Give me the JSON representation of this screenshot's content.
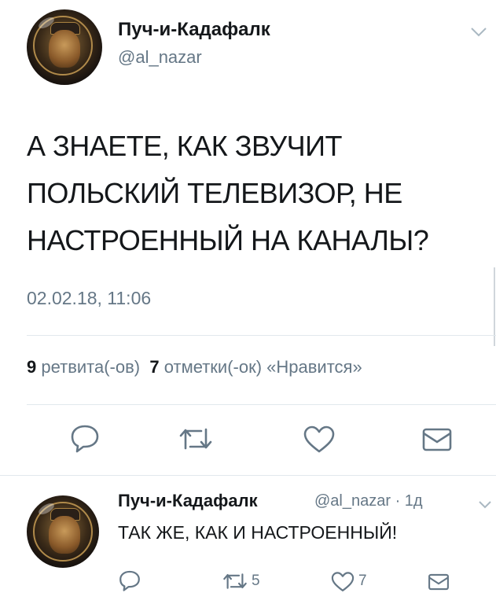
{
  "tweet": {
    "author_name": "Пуч-и-Кадафалк",
    "author_handle": "@al_nazar",
    "text_lines": [
      "А ЗНАЕТЕ, КАК ЗВУЧИТ",
      "ПОЛЬСКИЙ ТЕЛЕВИЗОР, НЕ",
      "НАСТРОЕННЫЙ НА КАНАЛЫ?"
    ],
    "timestamp": "02.02.18, 11:06",
    "retweet_count": "9",
    "retweet_label": "ретвита(-ов)",
    "like_count": "7",
    "like_label": "отметки(-ок) «Нравится»"
  },
  "reply": {
    "author_name": "Пуч-и-Кадафалк",
    "meta": "@al_nazar · 1д",
    "text": "ТАК ЖЕ, КАК И НАСТРОЕННЫЙ!",
    "retweet_count": "5",
    "like_count": "7"
  },
  "icons": {
    "reply": "reply-icon",
    "retweet": "retweet-icon",
    "like": "heart-icon",
    "message": "envelope-icon",
    "menu": "chevron-down-icon"
  },
  "colors": {
    "text": "#14171a",
    "secondary": "#657786",
    "divider": "#e1e8ed"
  }
}
